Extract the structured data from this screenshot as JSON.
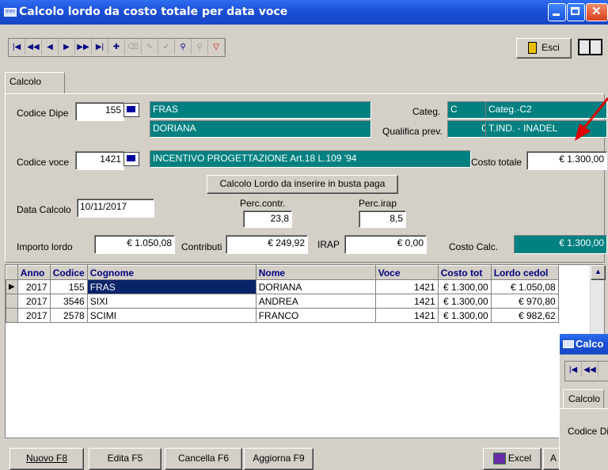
{
  "window": {
    "title": "Calcolo lordo da costo totale per data voce",
    "app_icon": "tmm"
  },
  "toolbar": {
    "exit_label": "Esci"
  },
  "tabs": [
    {
      "label": "Calcolo"
    }
  ],
  "form": {
    "codice_dipe_label": "Codice Dipe",
    "codice_dipe_value": "155",
    "cognome": "FRAS",
    "nome": "DORIANA",
    "categ_label": "Categ.",
    "categ_code": "C",
    "categ_desc": "Categ.-C2",
    "qualifica_label": "Qualifica prev.",
    "qualifica_code": "0",
    "qualifica_desc": "T.IND. - INADEL",
    "codice_voce_label": "Codice voce",
    "codice_voce_value": "1421",
    "voce_desc": "INCENTIVO PROGETTAZIONE Art.18 L.109 '94",
    "costo_totale_label": "Costo totale",
    "costo_totale_value": "€ 1.300,00",
    "calc_button": "Calcolo Lordo da inserire in busta paga",
    "data_calcolo_label": "Data Calcolo",
    "data_calcolo_value": "10/11/2017",
    "perc_contr_label": "Perc.contr.",
    "perc_contr_value": "23,8",
    "perc_irap_label": "Perc.irap",
    "perc_irap_value": "8,5",
    "importo_lordo_label": "Importo lordo",
    "importo_lordo_value": "€ 1.050,08",
    "contributi_label": "Contributi",
    "contributi_value": "€ 249,92",
    "irap_label": "IRAP",
    "irap_value": "€ 0,00",
    "costo_calc_label": "Costo Calc.",
    "costo_calc_value": "€ 1.300,00"
  },
  "table": {
    "columns": [
      "Anno",
      "Codice",
      "Cognome",
      "Nome",
      "Voce",
      "Costo tot",
      "Lordo cedol"
    ],
    "rows": [
      [
        "2017",
        "155",
        "FRAS",
        "DORIANA",
        "1421",
        "€ 1.300,00",
        "€ 1.050,08"
      ],
      [
        "2017",
        "3546",
        "SIXI",
        "ANDREA",
        "1421",
        "€ 1.300,00",
        "€ 970,80"
      ],
      [
        "2017",
        "2578",
        "SCIMI",
        "FRANCO",
        "1421",
        "€ 1.300,00",
        "€ 982,62"
      ]
    ]
  },
  "bottom": {
    "nuovo": "Nuovo F8",
    "edita": "Edita F5",
    "cancella": "Cancella F6",
    "aggiorna": "Aggiorna F9",
    "excel": "Excel",
    "partial": "A"
  },
  "subwindow": {
    "title": "Calco",
    "tab": "Calcolo",
    "field_label": "Codice Di"
  },
  "colors": {
    "title_blue": "#1a50d8",
    "teal": "#008080",
    "selection": "#0a246a",
    "arrow": "#e00000"
  }
}
